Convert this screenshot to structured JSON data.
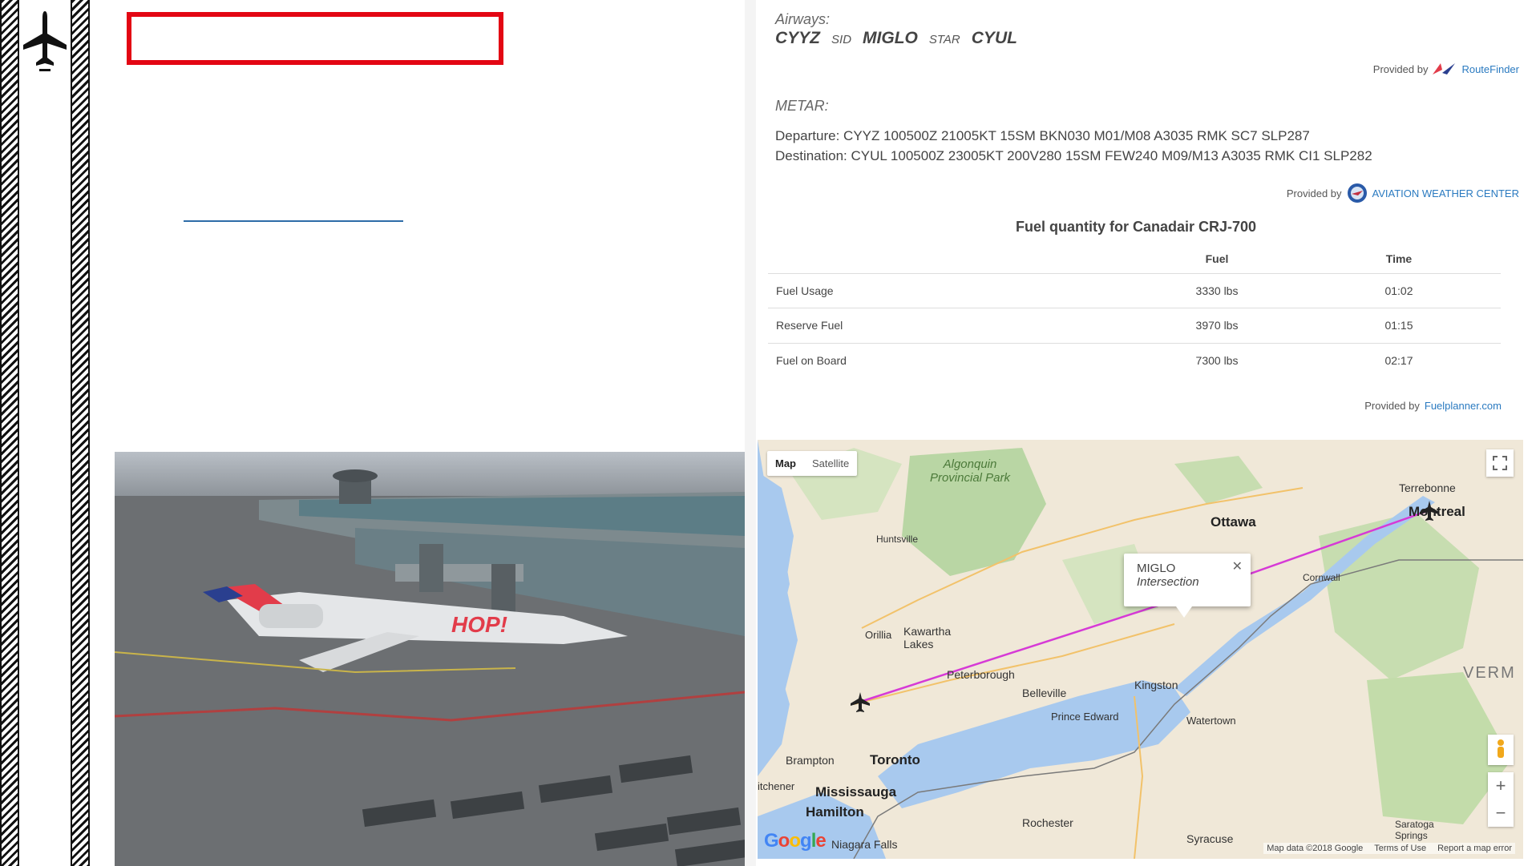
{
  "slide": {
    "title": "",
    "airways_label": "Airways:",
    "route": [
      "CYYZ",
      "SID",
      "MIGLO",
      "STAR",
      "CYUL"
    ],
    "routefinder_provided": "Provided by",
    "routefinder_name": "RouteFinder",
    "metar_label": "METAR:",
    "metar_departure": "Departure: CYYZ 100500Z 21005KT 15SM BKN030 M01/M08 A3035 RMK SC7 SLP287",
    "metar_destination": "Destination: CYUL 100500Z 23005KT 200V280 15SM FEW240 M09/M13 A3035 RMK CI1 SLP282",
    "awc_provided": "Provided by",
    "awc_name": "AVIATION WEATHER CENTER"
  },
  "fuel": {
    "title": "Fuel quantity for Canadair CRJ-700",
    "headers": [
      "",
      "Fuel",
      "Time"
    ],
    "rows": [
      {
        "label": "Fuel Usage",
        "fuel": "3330 lbs",
        "time": "01:02"
      },
      {
        "label": "Reserve Fuel",
        "fuel": "3970 lbs",
        "time": "01:15"
      },
      {
        "label": "Fuel on Board",
        "fuel": "7300 lbs",
        "time": "02:17"
      }
    ],
    "provided": "Provided by",
    "provider": "Fuelplanner.com"
  },
  "map": {
    "tab_map": "Map",
    "tab_satellite": "Satellite",
    "popup_title": "MIGLO",
    "popup_subtitle": "Intersection",
    "google": "Google",
    "footer_data": "Map data ©2018 Google",
    "footer_terms": "Terms of Use",
    "footer_report": "Report a map error",
    "places": {
      "park": "Algonquin Provincial Park",
      "ottawa": "Ottawa",
      "montreal": "Montreal",
      "terrebonne": "Terrebonne",
      "huntsville": "Huntsville",
      "orillia": "Orillia",
      "kawartha": "Kawartha Lakes",
      "peterborough": "Peterborough",
      "belleville": "Belleville",
      "kingston": "Kingston",
      "prince_edward": "Prince Edward",
      "watertown": "Watertown",
      "cornwall": "Cornwall",
      "brampton": "Brampton",
      "toronto": "Toronto",
      "mississauga": "Mississauga",
      "kitchener": "itchener",
      "hamilton": "Hamilton",
      "rochester": "Rochester",
      "syracuse": "Syracuse",
      "niagara": "Niagara Falls",
      "saratoga": "Saratoga Springs",
      "vermont": "VERM"
    }
  },
  "colors": {
    "accent_red": "#e30613",
    "route_line": "#d63ad6",
    "link_blue": "#2a7ac0"
  }
}
